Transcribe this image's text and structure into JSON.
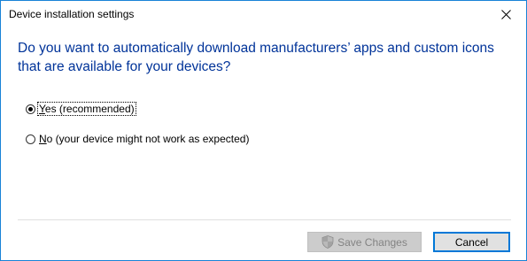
{
  "window": {
    "title": "Device installation settings"
  },
  "dialog": {
    "question": "Do you want to automatically download manufacturers’ apps and custom icons that are available for your devices?",
    "options": [
      {
        "mnemonic": "Y",
        "label_rest": "es (recommended)",
        "selected": true
      },
      {
        "mnemonic": "N",
        "label_rest": "o (your device might not work as expected)",
        "selected": false
      }
    ]
  },
  "footer": {
    "save_label": "Save Changes",
    "save_enabled": false,
    "cancel_label": "Cancel"
  },
  "icons": {
    "close": "close-icon",
    "save": "uac-shield-icon"
  },
  "colors": {
    "accent": "#0078d7",
    "question_text": "#003399"
  }
}
